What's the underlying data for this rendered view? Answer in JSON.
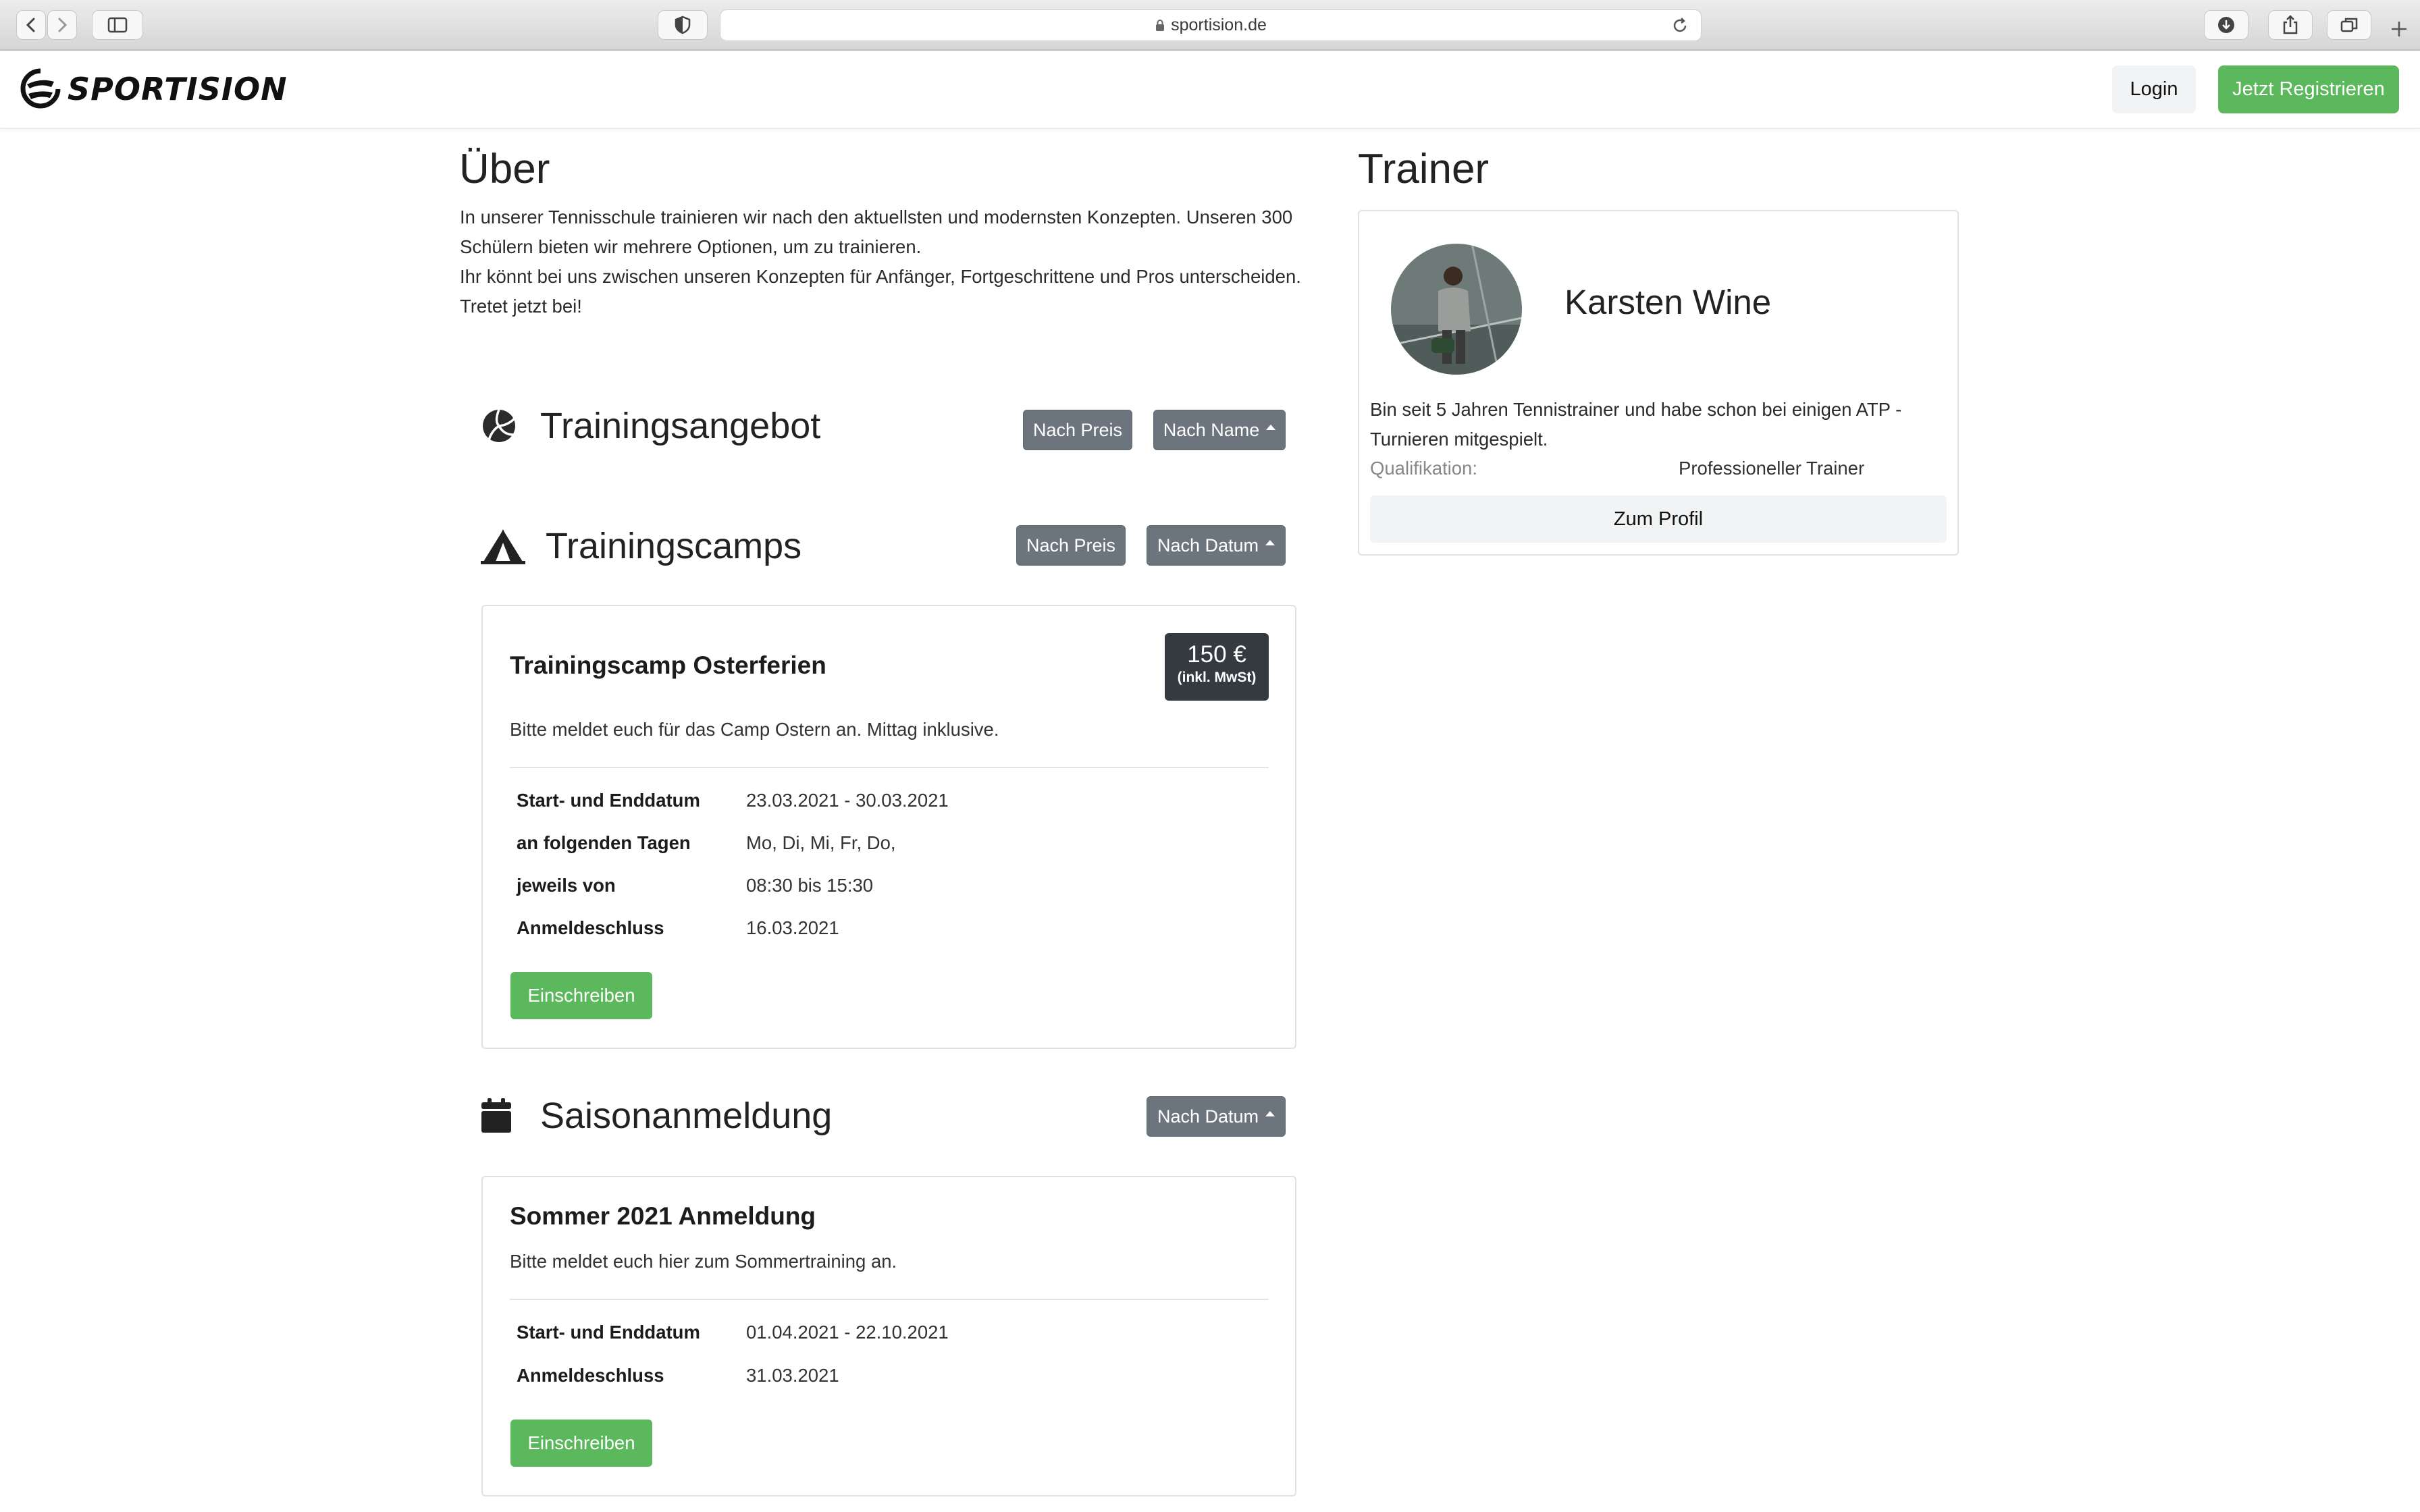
{
  "browser": {
    "url": "sportision.de"
  },
  "header": {
    "logo_text": "SPORTISION",
    "login_label": "Login",
    "register_label": "Jetzt Registrieren"
  },
  "about": {
    "title": "Über",
    "lines": [
      "In unserer Tennisschule trainieren wir nach den aktuellsten und modernsten Konzepten. Unseren 300",
      "Schülern bieten wir mehrere Optionen, um zu trainieren.",
      "Ihr könnt bei uns zwischen unseren Konzepten für Anfänger, Fortgeschrittene und Pros unterscheiden.",
      "Tretet jetzt bei!"
    ]
  },
  "training_offer": {
    "title": "Trainingsangebot",
    "sort_price": "Nach Preis",
    "sort_name": "Nach Name"
  },
  "training_camps": {
    "title": "Trainingscamps",
    "sort_price": "Nach Preis",
    "sort_date": "Nach Datum",
    "items": [
      {
        "title": "Trainingscamp Osterferien",
        "price": "150 €",
        "price_note": "(inkl. MwSt)",
        "description": "Bitte meldet euch für das Camp Ostern an. Mittag inklusive.",
        "details": [
          {
            "label": "Start- und Enddatum",
            "value": "23.03.2021 - 30.03.2021"
          },
          {
            "label": "an folgenden Tagen",
            "value": "Mo, Di, Mi, Fr, Do,"
          },
          {
            "label": "jeweils von",
            "value": "08:30 bis 15:30"
          },
          {
            "label": "Anmeldeschluss",
            "value": "16.03.2021"
          }
        ],
        "button": "Einschreiben"
      }
    ]
  },
  "season": {
    "title": "Saisonanmeldung",
    "sort_date": "Nach Datum",
    "items": [
      {
        "title": "Sommer 2021 Anmeldung",
        "description": "Bitte meldet euch hier zum Sommertraining an.",
        "details": [
          {
            "label": "Start- und Enddatum",
            "value": "01.04.2021 - 22.10.2021"
          },
          {
            "label": "Anmeldeschluss",
            "value": "31.03.2021"
          }
        ],
        "button": "Einschreiben"
      }
    ]
  },
  "trainer": {
    "title": "Trainer",
    "name": "Karsten Wine",
    "bio_lines": [
      "Bin seit 5 Jahren Tennistrainer und habe schon bei einigen ATP -",
      "Turnieren mitgespielt."
    ],
    "qualification_label": "Qualifikation:",
    "qualification_value": "Professioneller Trainer",
    "profile_button": "Zum Profil"
  },
  "colors": {
    "success": "#5cb85c",
    "secondary": "#6c757d",
    "dark": "#343a40"
  }
}
